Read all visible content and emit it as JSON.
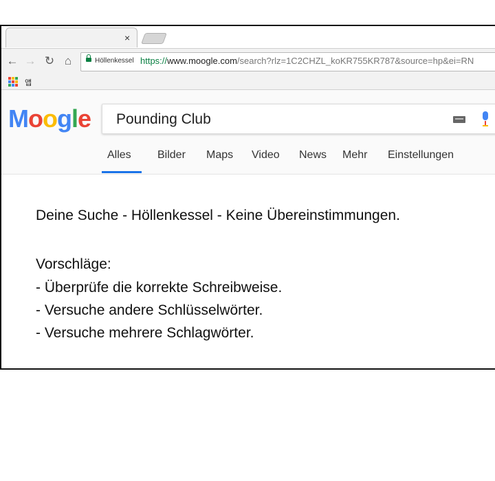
{
  "browser": {
    "tab_close": "×",
    "nav": {
      "back": "←",
      "forward": "→",
      "reload": "↻",
      "home": "⌂"
    },
    "omnibox": {
      "site_label": "Höllenkessel",
      "scheme": "https://",
      "host": "www.moogle.com",
      "path": "/search?rlz=1C2CHZL_koKR755KR787&source=hp&ei=RN"
    },
    "bookmarks": {
      "apps_label": "앱"
    }
  },
  "search": {
    "logo": [
      "M",
      "o",
      "o",
      "g",
      "l",
      "e"
    ],
    "logo_colors": [
      "#4285f4",
      "#ea4335",
      "#fbbc05",
      "#4285f4",
      "#34a853",
      "#ea4335"
    ],
    "query": "Pounding Club",
    "tabs": [
      "Alles",
      "Bilder",
      "Maps",
      "Video",
      "News",
      "Mehr",
      "Einstellungen"
    ],
    "active_tab": "Alles"
  },
  "results": {
    "no_match": "Deine Suche - Höllenkessel - Keine Übereinstimmungen.",
    "suggestions_heading": "Vorschläge:",
    "suggestions": [
      "- Überprüfe die korrekte Schreibweise.",
      "- Versuche andere Schlüsselwörter.",
      "- Versuche mehrere Schlagwörter."
    ]
  },
  "colors": {
    "accent": "#1a73e8",
    "secure": "#0b8043"
  }
}
